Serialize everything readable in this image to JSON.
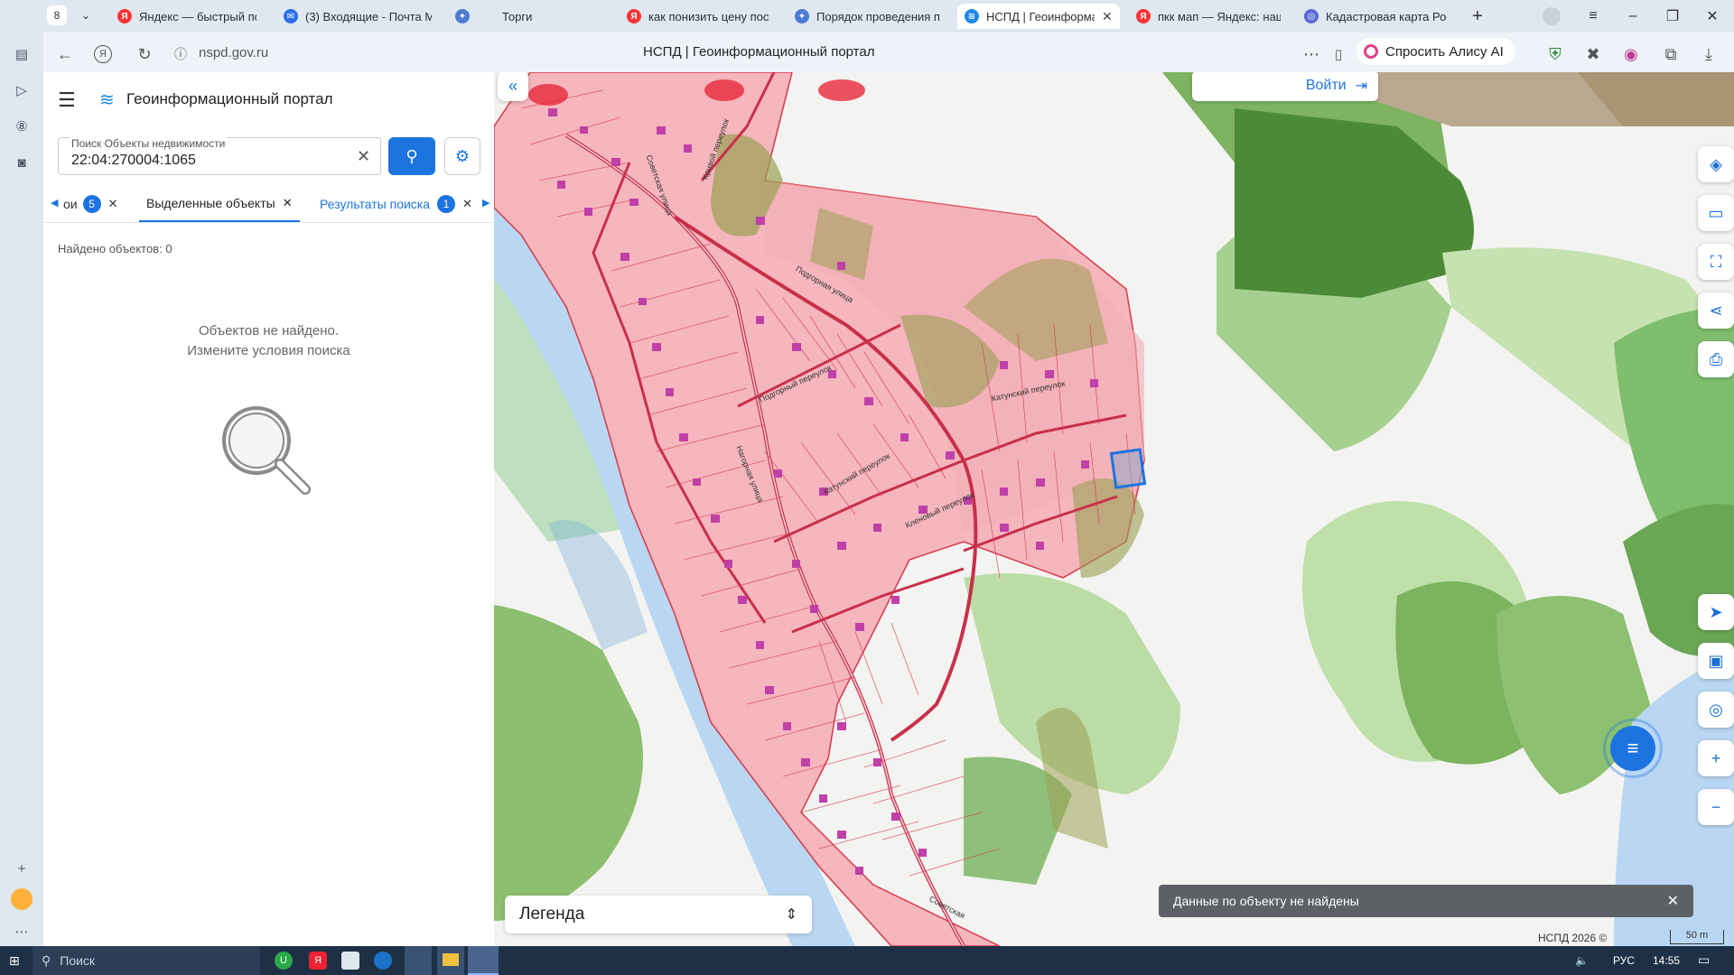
{
  "browser": {
    "tab_counter": "8",
    "tabs": [
      {
        "label": "Яндекс — быстрый пои",
        "color": "#f33"
      },
      {
        "label": "(3) Входящие - Почта М",
        "color": "#2a6ee8"
      },
      {
        "label": "Торги",
        "color": "#4b7bd1"
      },
      {
        "label": "как понизить цену пос",
        "color": "#f33"
      },
      {
        "label": "Порядок проведения п",
        "color": "#4b7bd1"
      },
      {
        "label": "НСПД | Геоинформаци",
        "color": "#1e88e5"
      },
      {
        "label": "пкк мап — Яндекс: наш",
        "color": "#f33"
      },
      {
        "label": "Кадастровая карта Рос",
        "color": "#5a6bd6"
      }
    ],
    "url": "nspd.gov.ru",
    "page_title": "НСПД | Геоинформационный портал",
    "alice_label": "Спросить Алису AI"
  },
  "portal": {
    "title": "Геоинформационный портал",
    "search_label": "Поиск Объекты недвижимости",
    "search_value": "22:04:270004:1065",
    "tabs": [
      {
        "label": "ои",
        "badge": "5"
      },
      {
        "label": "Выделенные объекты"
      },
      {
        "label": "Результаты поиска",
        "badge": "1"
      }
    ],
    "found_count": "Найдено объектов: 0",
    "empty_line1": "Объектов не найдено.",
    "empty_line2": "Измените условия поиска"
  },
  "map": {
    "login_label": "Войти",
    "legend_label": "Легенда",
    "toast": "Данные по объекту не найдены",
    "copyright": "НСПД 2026 ©",
    "scale": "50 m",
    "street_labels": [
      "Советская улица",
      "Кривой переулок",
      "Подгорная улица",
      "Подгорный переулок",
      "Катунский переулок",
      "Катунский переулок",
      "Кленовый переулок",
      "Нагорная улица",
      "Советская"
    ],
    "colors": {
      "parcel_fill": "#f5b6bd",
      "parcel_stroke": "#d8384a",
      "river": "#b9d7f3",
      "forest": "#8fc37a",
      "dark_forest": "#4f8f3d",
      "building": "#c040a8"
    }
  },
  "taskbar": {
    "search_placeholder": "Поиск",
    "lang": "РУС",
    "time": "14:55"
  }
}
